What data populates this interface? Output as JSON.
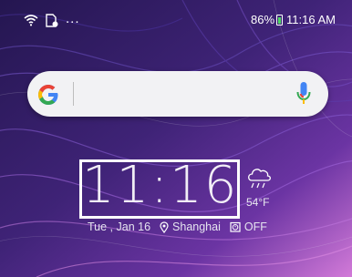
{
  "status_bar": {
    "battery_percent": "86%",
    "time": "11:16 AM",
    "more_indicator": "...",
    "icons": [
      "wifi-icon",
      "notification-icon",
      "battery-icon"
    ]
  },
  "search_widget": {
    "logo": "G",
    "icons": [
      "google-logo-icon",
      "mic-icon"
    ]
  },
  "clock_widget": {
    "time": "11:16",
    "temperature": "54°F",
    "date": "Tue , Jan 16",
    "location": "Shanghai",
    "alarm": "OFF",
    "icons": [
      "cloud-rain-icon",
      "location-pin-icon",
      "alarm-icon"
    ]
  },
  "colors": {
    "battery_fill": "#4cd964",
    "google_blue": "#4285F4",
    "google_red": "#EA4335",
    "google_yellow": "#FBBC05",
    "google_green": "#34A853"
  }
}
